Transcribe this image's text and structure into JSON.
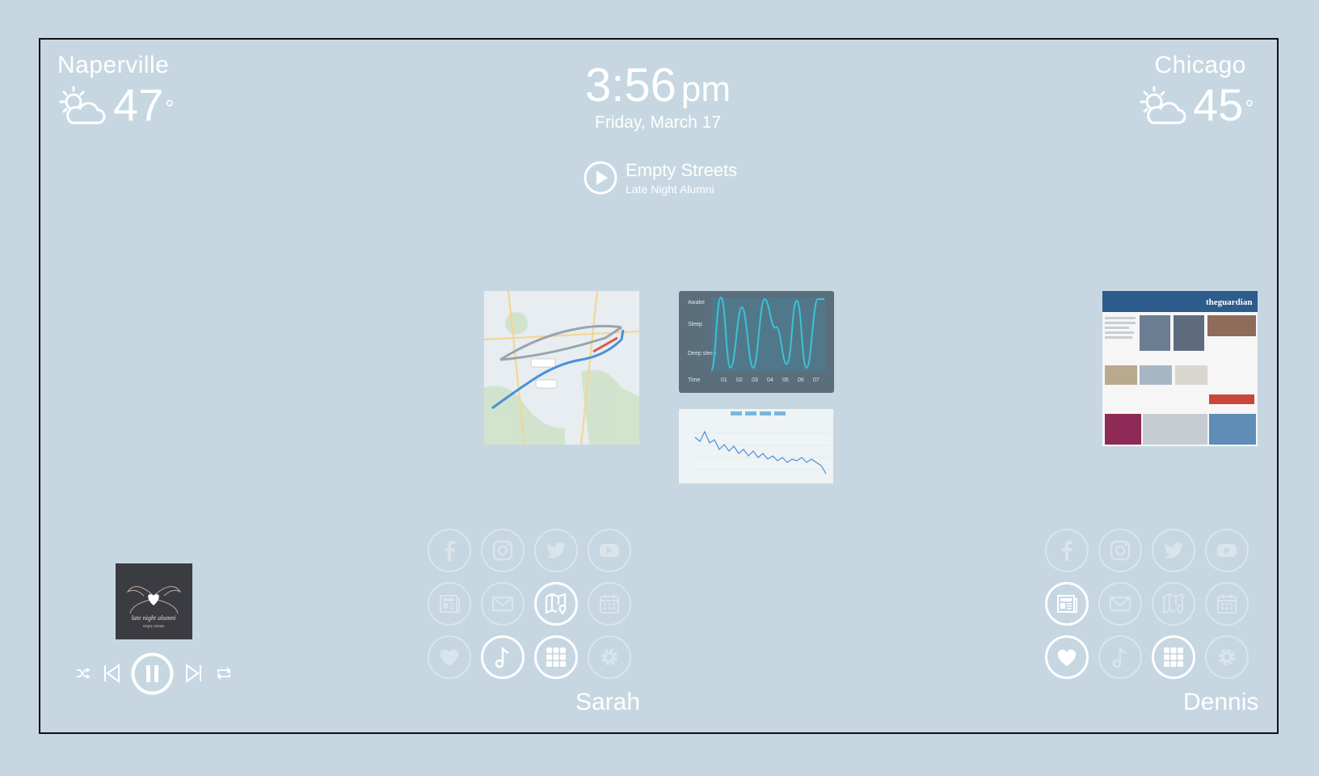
{
  "weather_left": {
    "city": "Naperville",
    "temp": "47",
    "deg": "°",
    "icon": "partly-sunny-icon"
  },
  "weather_right": {
    "city": "Chicago",
    "temp": "45",
    "deg": "°",
    "icon": "partly-sunny-icon"
  },
  "clock": {
    "time": "3:56",
    "ampm": "pm",
    "date": "Friday, March 17"
  },
  "now_playing": {
    "title": "Empty Streets",
    "artist": "Late Night Alumni"
  },
  "sleep_chart": {
    "labels": [
      "Awake",
      "Sleep",
      "Deep sleep",
      "Time"
    ],
    "hours": [
      "01",
      "02",
      "03",
      "04",
      "05",
      "06",
      "07"
    ]
  },
  "news": {
    "brand": "theguardian"
  },
  "album_art": {
    "line1": "late night alumni",
    "line2": "empty streets"
  },
  "users": [
    {
      "name": "Sarah"
    },
    {
      "name": "Dennis"
    }
  ],
  "colors": {
    "background": "#c6d7e1",
    "text": "#ffffff",
    "frame": "#111111",
    "sleep_panel": "#5a6e7c",
    "sleep_line": "#3cc2d6"
  }
}
